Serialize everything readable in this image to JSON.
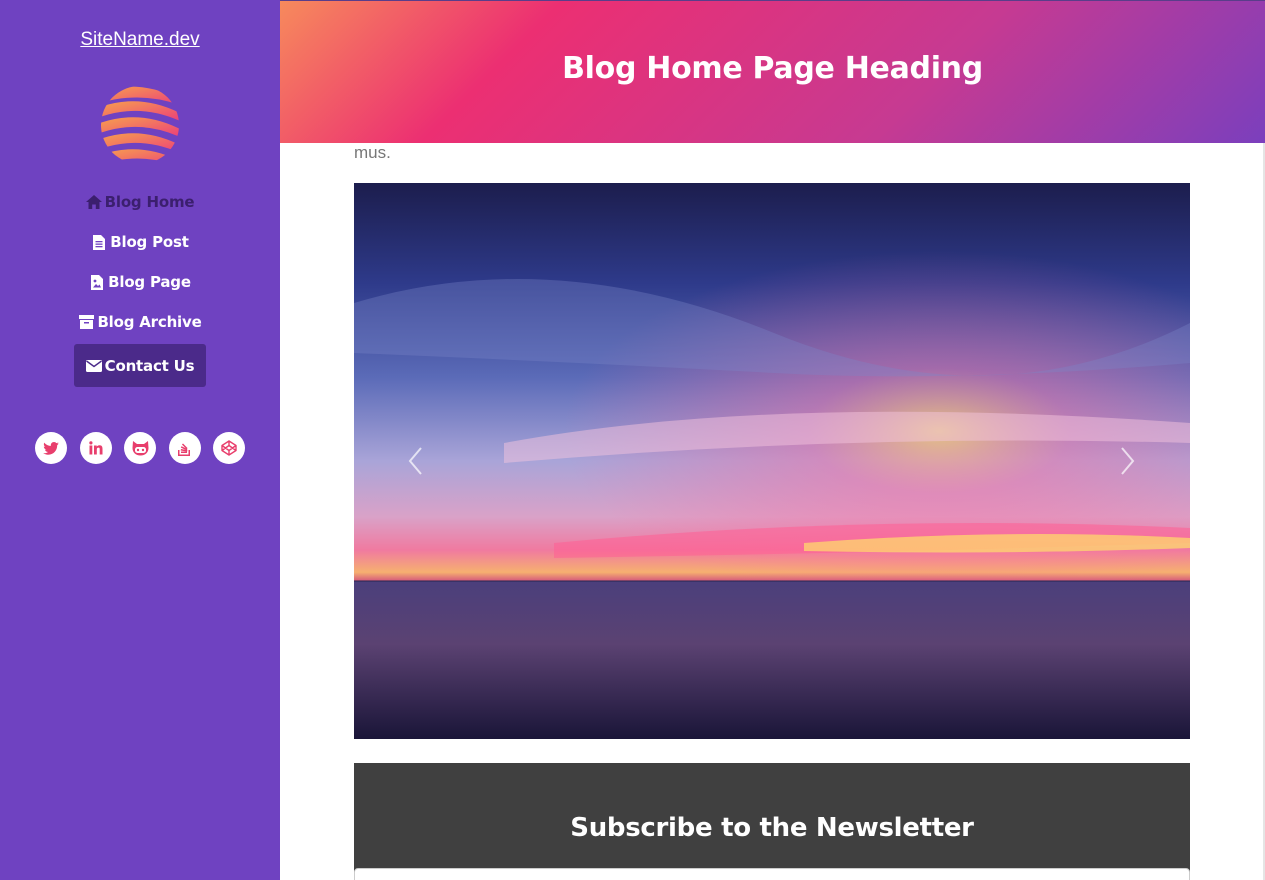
{
  "sidebar": {
    "site_name": "SiteName.dev",
    "nav": [
      {
        "label": "Blog Home",
        "icon": "home-icon"
      },
      {
        "label": "Blog Post",
        "icon": "file-icon"
      },
      {
        "label": "Blog Page",
        "icon": "file-image-icon"
      },
      {
        "label": "Blog Archive",
        "icon": "archive-icon"
      },
      {
        "label": "Contact Us",
        "icon": "envelope-icon",
        "active": true
      }
    ],
    "social": [
      "twitter-icon",
      "linkedin-icon",
      "github-icon",
      "stack-overflow-icon",
      "codepen-icon"
    ]
  },
  "header": {
    "title": "Blog Home Page Heading"
  },
  "main": {
    "truncated_text": "mus.",
    "carousel": {
      "image": "sunset over sea",
      "prev": "chevron-left-icon",
      "next": "chevron-right-icon"
    }
  },
  "newsletter": {
    "title": "Subscribe to the Newsletter"
  },
  "colors": {
    "sidebar": "#6f42c1",
    "accent": "#ec2f72",
    "newsletter_bg": "#404040"
  }
}
